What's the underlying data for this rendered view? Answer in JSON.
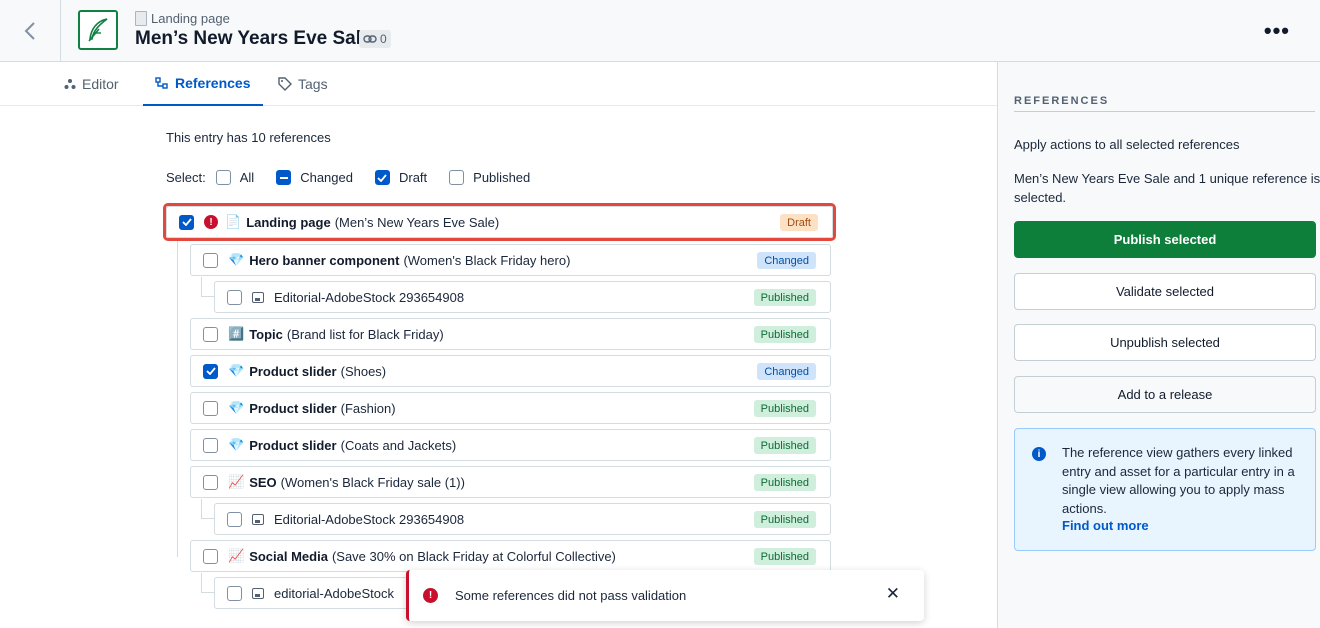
{
  "header": {
    "back_label": "‹",
    "content_type": "Landing page",
    "title": "Men’s New Years Eve Sale",
    "link_count": "0",
    "more_label": "•••"
  },
  "tabs": [
    {
      "label": "Editor"
    },
    {
      "label": "References"
    },
    {
      "label": "Tags"
    }
  ],
  "main": {
    "ref_count_text": "This entry has 10 references",
    "select_label": "Select:",
    "select_options": [
      "All",
      "Changed",
      "Draft",
      "Published"
    ],
    "rows": [
      {
        "title": "Landing page",
        "subtitle": "(Men’s New Years Eve Sale)",
        "status": "Draft",
        "emoji": "📄",
        "checked": true,
        "error": true
      },
      {
        "title": "Hero banner component",
        "subtitle": "(Women's Black Friday hero)",
        "status": "Changed",
        "emoji": "💎",
        "checked": false
      },
      {
        "title": "Editorial-AdobeStock 293654908",
        "subtitle": "",
        "status": "Published",
        "asset": true,
        "checked": false
      },
      {
        "title": "Topic",
        "subtitle": "(Brand list for Black Friday)",
        "status": "Published",
        "emoji": "#️⃣",
        "checked": false
      },
      {
        "title": "Product slider",
        "subtitle": "(Shoes)",
        "status": "Changed",
        "emoji": "💎",
        "checked": true
      },
      {
        "title": "Product slider",
        "subtitle": "(Fashion)",
        "status": "Published",
        "emoji": "💎",
        "checked": false
      },
      {
        "title": "Product slider",
        "subtitle": "(Coats and Jackets)",
        "status": "Published",
        "emoji": "💎",
        "checked": false
      },
      {
        "title": "SEO",
        "subtitle": "(Women's Black Friday sale (1))",
        "status": "Published",
        "emoji": "📈",
        "checked": false
      },
      {
        "title": "Editorial-AdobeStock 293654908",
        "subtitle": "",
        "status": "Published",
        "asset": true,
        "checked": false
      },
      {
        "title": "Social Media",
        "subtitle": "(Save 30% on Black Friday at Colorful Collective)",
        "status": "Published",
        "emoji": "📈",
        "checked": false
      },
      {
        "title": "editorial-AdobeStock",
        "subtitle": "",
        "status": "",
        "asset": true,
        "checked": false
      }
    ]
  },
  "toast": {
    "message": "Some references did not pass validation",
    "close_label": "✕"
  },
  "sidebar": {
    "heading": "REFERENCES",
    "apply_text": "Apply actions to all selected references",
    "selection_text": "Men’s New Years Eve Sale and 1 unique reference is selected.",
    "buttons": {
      "publish": "Publish selected",
      "validate": "Validate selected",
      "unpublish": "Unpublish selected",
      "release": "Add to a release"
    },
    "info_text": "The reference view gathers every linked entry and asset for a particular entry in a single view allowing you to apply mass actions.",
    "info_link": "Find out more"
  },
  "colors": {
    "primary_blue": "#0059c8",
    "publish_green": "#0e7e3b",
    "error_red": "#c8102e",
    "highlight_red": "#e2483d"
  }
}
